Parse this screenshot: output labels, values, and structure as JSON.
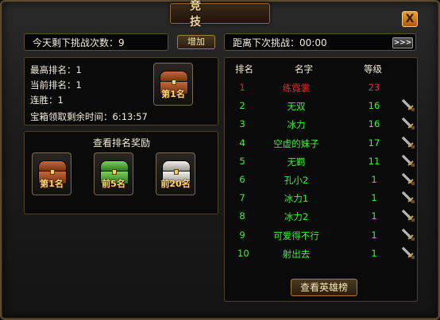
{
  "window": {
    "title": "竞 技",
    "close": "X"
  },
  "top_bar": {
    "challenges_left": "今天剩下挑战次数：9",
    "add_label": "增加",
    "next_challenge": "距离下次挑战：00:00",
    "skip_label": ">>>"
  },
  "stats": {
    "best_rank": "最高排名：1",
    "current_rank": "当前排名：1",
    "streak": "连胜：1",
    "chest_timer": "宝箱领取剩余时间：6:13:57",
    "chest_label": "第1名"
  },
  "rewards": {
    "title": "查看排名奖励",
    "items": [
      {
        "label": "第1名",
        "tier": "bronze"
      },
      {
        "label": "前5名",
        "tier": "green"
      },
      {
        "label": "前20名",
        "tier": "silver"
      }
    ]
  },
  "ranking": {
    "headers": {
      "rank": "排名",
      "name": "名字",
      "level": "等级"
    },
    "rows": [
      {
        "rank": "1",
        "name": "练霓裳",
        "level": "23",
        "color": "#f02828"
      },
      {
        "rank": "2",
        "name": "无双",
        "level": "16",
        "color": "#3ef03e"
      },
      {
        "rank": "3",
        "name": "冰力",
        "level": "16",
        "color": "#3ef03e"
      },
      {
        "rank": "4",
        "name": "空虚的妹子",
        "level": "17",
        "color": "#3ef03e"
      },
      {
        "rank": "5",
        "name": "无羁",
        "level": "11",
        "color": "#3ef03e"
      },
      {
        "rank": "6",
        "name": "孔小2",
        "level": "1",
        "color": "#3ef03e"
      },
      {
        "rank": "7",
        "name": "冰力1",
        "level": "1",
        "color": "#3ef03e"
      },
      {
        "rank": "8",
        "name": "冰力2",
        "level": "1",
        "color": "#3ef03e"
      },
      {
        "rank": "9",
        "name": "可爱得不行",
        "level": "1",
        "color": "#3ef03e"
      },
      {
        "rank": "10",
        "name": "射出去",
        "level": "1",
        "color": "#3ef03e"
      }
    ],
    "heroes_button": "查看英雄榜",
    "challenge_icon": "sword-icon"
  }
}
